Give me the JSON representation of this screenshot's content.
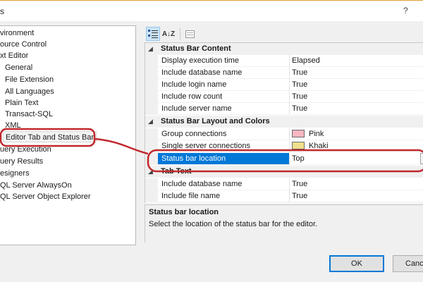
{
  "window": {
    "title": "s",
    "help": "?"
  },
  "tree": {
    "items": [
      {
        "label": "vironment",
        "indent": 0
      },
      {
        "label": "ource Control",
        "indent": 0
      },
      {
        "label": "xt Editor",
        "indent": 0
      },
      {
        "label": "General",
        "indent": 1
      },
      {
        "label": "File Extension",
        "indent": 1
      },
      {
        "label": "All Languages",
        "indent": 1
      },
      {
        "label": "Plain Text",
        "indent": 1
      },
      {
        "label": "Transact-SQL",
        "indent": 1
      },
      {
        "label": "XML",
        "indent": 1
      },
      {
        "label": "Editor Tab and Status Bar",
        "indent": 1,
        "selected": true
      },
      {
        "label": "uery Execution",
        "indent": 0
      },
      {
        "label": "uery Results",
        "indent": 0
      },
      {
        "label": "esigners",
        "indent": 0
      },
      {
        "label": "QL Server AlwaysOn",
        "indent": 0
      },
      {
        "label": "QL Server Object Explorer",
        "indent": 0
      }
    ]
  },
  "toolbar": {
    "categorized_icon": "categorized-icon",
    "alphabetical_label": "A↓Z",
    "property_pages_icon": "property-pages-icon"
  },
  "grid": {
    "rows": [
      {
        "type": "category",
        "label": "Status Bar Content"
      },
      {
        "type": "prop",
        "name": "Display execution time",
        "value": "Elapsed"
      },
      {
        "type": "prop",
        "name": "Include database name",
        "value": "True"
      },
      {
        "type": "prop",
        "name": "Include login name",
        "value": "True"
      },
      {
        "type": "prop",
        "name": "Include row count",
        "value": "True"
      },
      {
        "type": "prop",
        "name": "Include server name",
        "value": "True"
      },
      {
        "type": "category",
        "label": "Status Bar Layout and Colors"
      },
      {
        "type": "prop",
        "name": "Group connections",
        "value": "Pink",
        "swatch": "#f7b6c2"
      },
      {
        "type": "prop",
        "name": "Single server connections",
        "value": "Khaki",
        "swatch": "#f0e08c"
      },
      {
        "type": "prop",
        "name": "Status bar location",
        "value": "Top",
        "selected": true
      },
      {
        "type": "category",
        "label": "Tab Text"
      },
      {
        "type": "prop",
        "name": "Include database name",
        "value": "True"
      },
      {
        "type": "prop",
        "name": "Include file name",
        "value": "True"
      }
    ]
  },
  "description": {
    "title": "Status bar location",
    "text": "Select the location of the status bar for the editor."
  },
  "buttons": {
    "ok": "OK",
    "cancel": "Canc"
  },
  "colors": {
    "selection": "#0078d7",
    "annotation": "#c0282d"
  }
}
